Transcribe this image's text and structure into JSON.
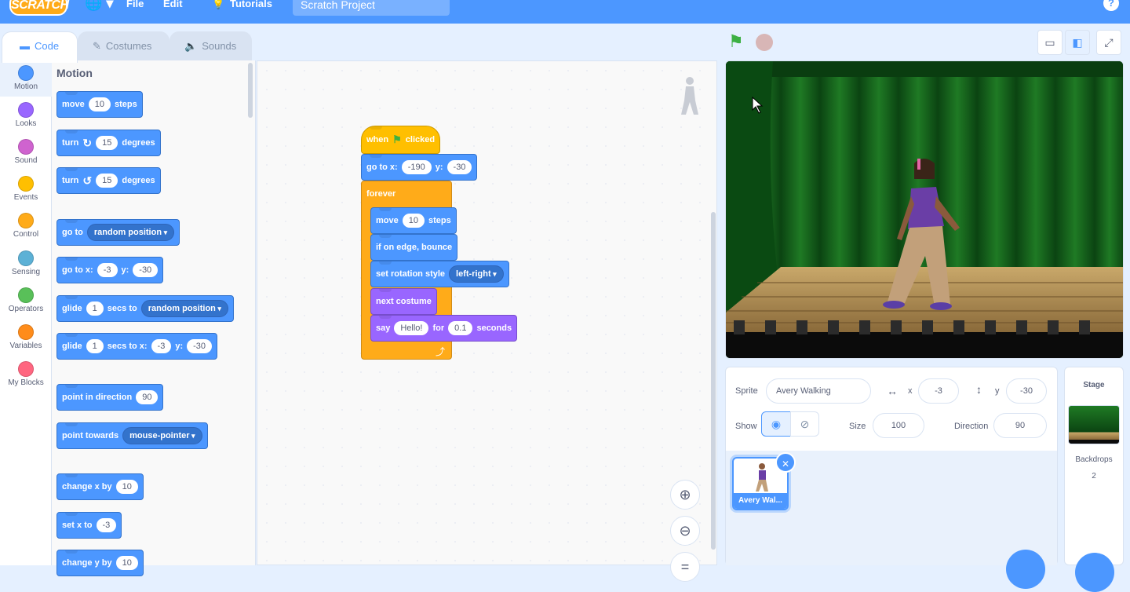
{
  "menu": {
    "logo": "SCRATCH",
    "file": "File",
    "edit": "Edit",
    "tutorials": "Tutorials",
    "project_title": "Scratch Project",
    "help": "?"
  },
  "tabs": [
    {
      "label": "Code",
      "active": true
    },
    {
      "label": "Costumes",
      "active": false
    },
    {
      "label": "Sounds",
      "active": false
    }
  ],
  "categories": [
    {
      "label": "Motion",
      "color": "#4c97ff"
    },
    {
      "label": "Looks",
      "color": "#9966ff"
    },
    {
      "label": "Sound",
      "color": "#cf63cf"
    },
    {
      "label": "Events",
      "color": "#ffbf00"
    },
    {
      "label": "Control",
      "color": "#ffab19"
    },
    {
      "label": "Sensing",
      "color": "#5cb1d6"
    },
    {
      "label": "Operators",
      "color": "#59c059"
    },
    {
      "label": "Variables",
      "color": "#ff8c1a"
    },
    {
      "label": "My Blocks",
      "color": "#ff6680"
    }
  ],
  "palette": {
    "title": "Motion",
    "move": {
      "a": "move",
      "v": "10",
      "b": "steps"
    },
    "turn_right": {
      "a": "turn",
      "v": "15",
      "b": "degrees"
    },
    "turn_left": {
      "a": "turn",
      "v": "15",
      "b": "degrees"
    },
    "goto": {
      "a": "go to",
      "d": "random position"
    },
    "goto_xy": {
      "a": "go to x:",
      "x": "-3",
      "y_lbl": "y:",
      "y": "-30"
    },
    "glide": {
      "a": "glide",
      "v": "1",
      "b": "secs to",
      "d": "random position"
    },
    "glide_xy": {
      "a": "glide",
      "v": "1",
      "b": "secs to x:",
      "x": "-3",
      "y_lbl": "y:",
      "y": "-30"
    },
    "point_dir": {
      "a": "point in direction",
      "v": "90"
    },
    "point_towards": {
      "a": "point towards",
      "d": "mouse-pointer"
    },
    "change_x": {
      "a": "change x by",
      "v": "10"
    },
    "set_x": {
      "a": "set x to",
      "v": "-3"
    },
    "change_y": {
      "a": "change y by",
      "v": "10"
    }
  },
  "script": {
    "hat": {
      "a": "when",
      "b": "clicked"
    },
    "goto_xy": {
      "a": "go to x:",
      "x": "-190",
      "y_lbl": "y:",
      "y": "-30"
    },
    "forever": "forever",
    "move": {
      "a": "move",
      "v": "10",
      "b": "steps"
    },
    "bounce": "if on edge, bounce",
    "rotation": {
      "a": "set rotation style",
      "d": "left-right"
    },
    "next_costume": "next costume",
    "say": {
      "a": "say",
      "v": "Hello!",
      "b": "for",
      "t": "0.1",
      "c": "seconds"
    }
  },
  "sprite_info": {
    "sprite_label": "Sprite",
    "sprite_name": "Avery Walking",
    "x_label": "x",
    "x": "-3",
    "y_label": "y",
    "y": "-30",
    "show_label": "Show",
    "size_label": "Size",
    "size": "100",
    "direction_label": "Direction",
    "direction": "90"
  },
  "sprite_list": [
    {
      "name": "Avery Wal..."
    }
  ],
  "stage_panel": {
    "title": "Stage",
    "backdrops_label": "Backdrops",
    "backdrops_count": "2"
  },
  "icons": {
    "green_flag": "green-flag-icon",
    "stop": "stop-icon",
    "zoom_in": "zoom-in-icon",
    "zoom_out": "zoom-out-icon",
    "zoom_reset": "zoom-reset-icon"
  },
  "colors": {
    "accent": "#4c97ff",
    "motion": "#4c97ff",
    "looks": "#9966ff",
    "control": "#ffab19",
    "events": "#ffbf00"
  }
}
